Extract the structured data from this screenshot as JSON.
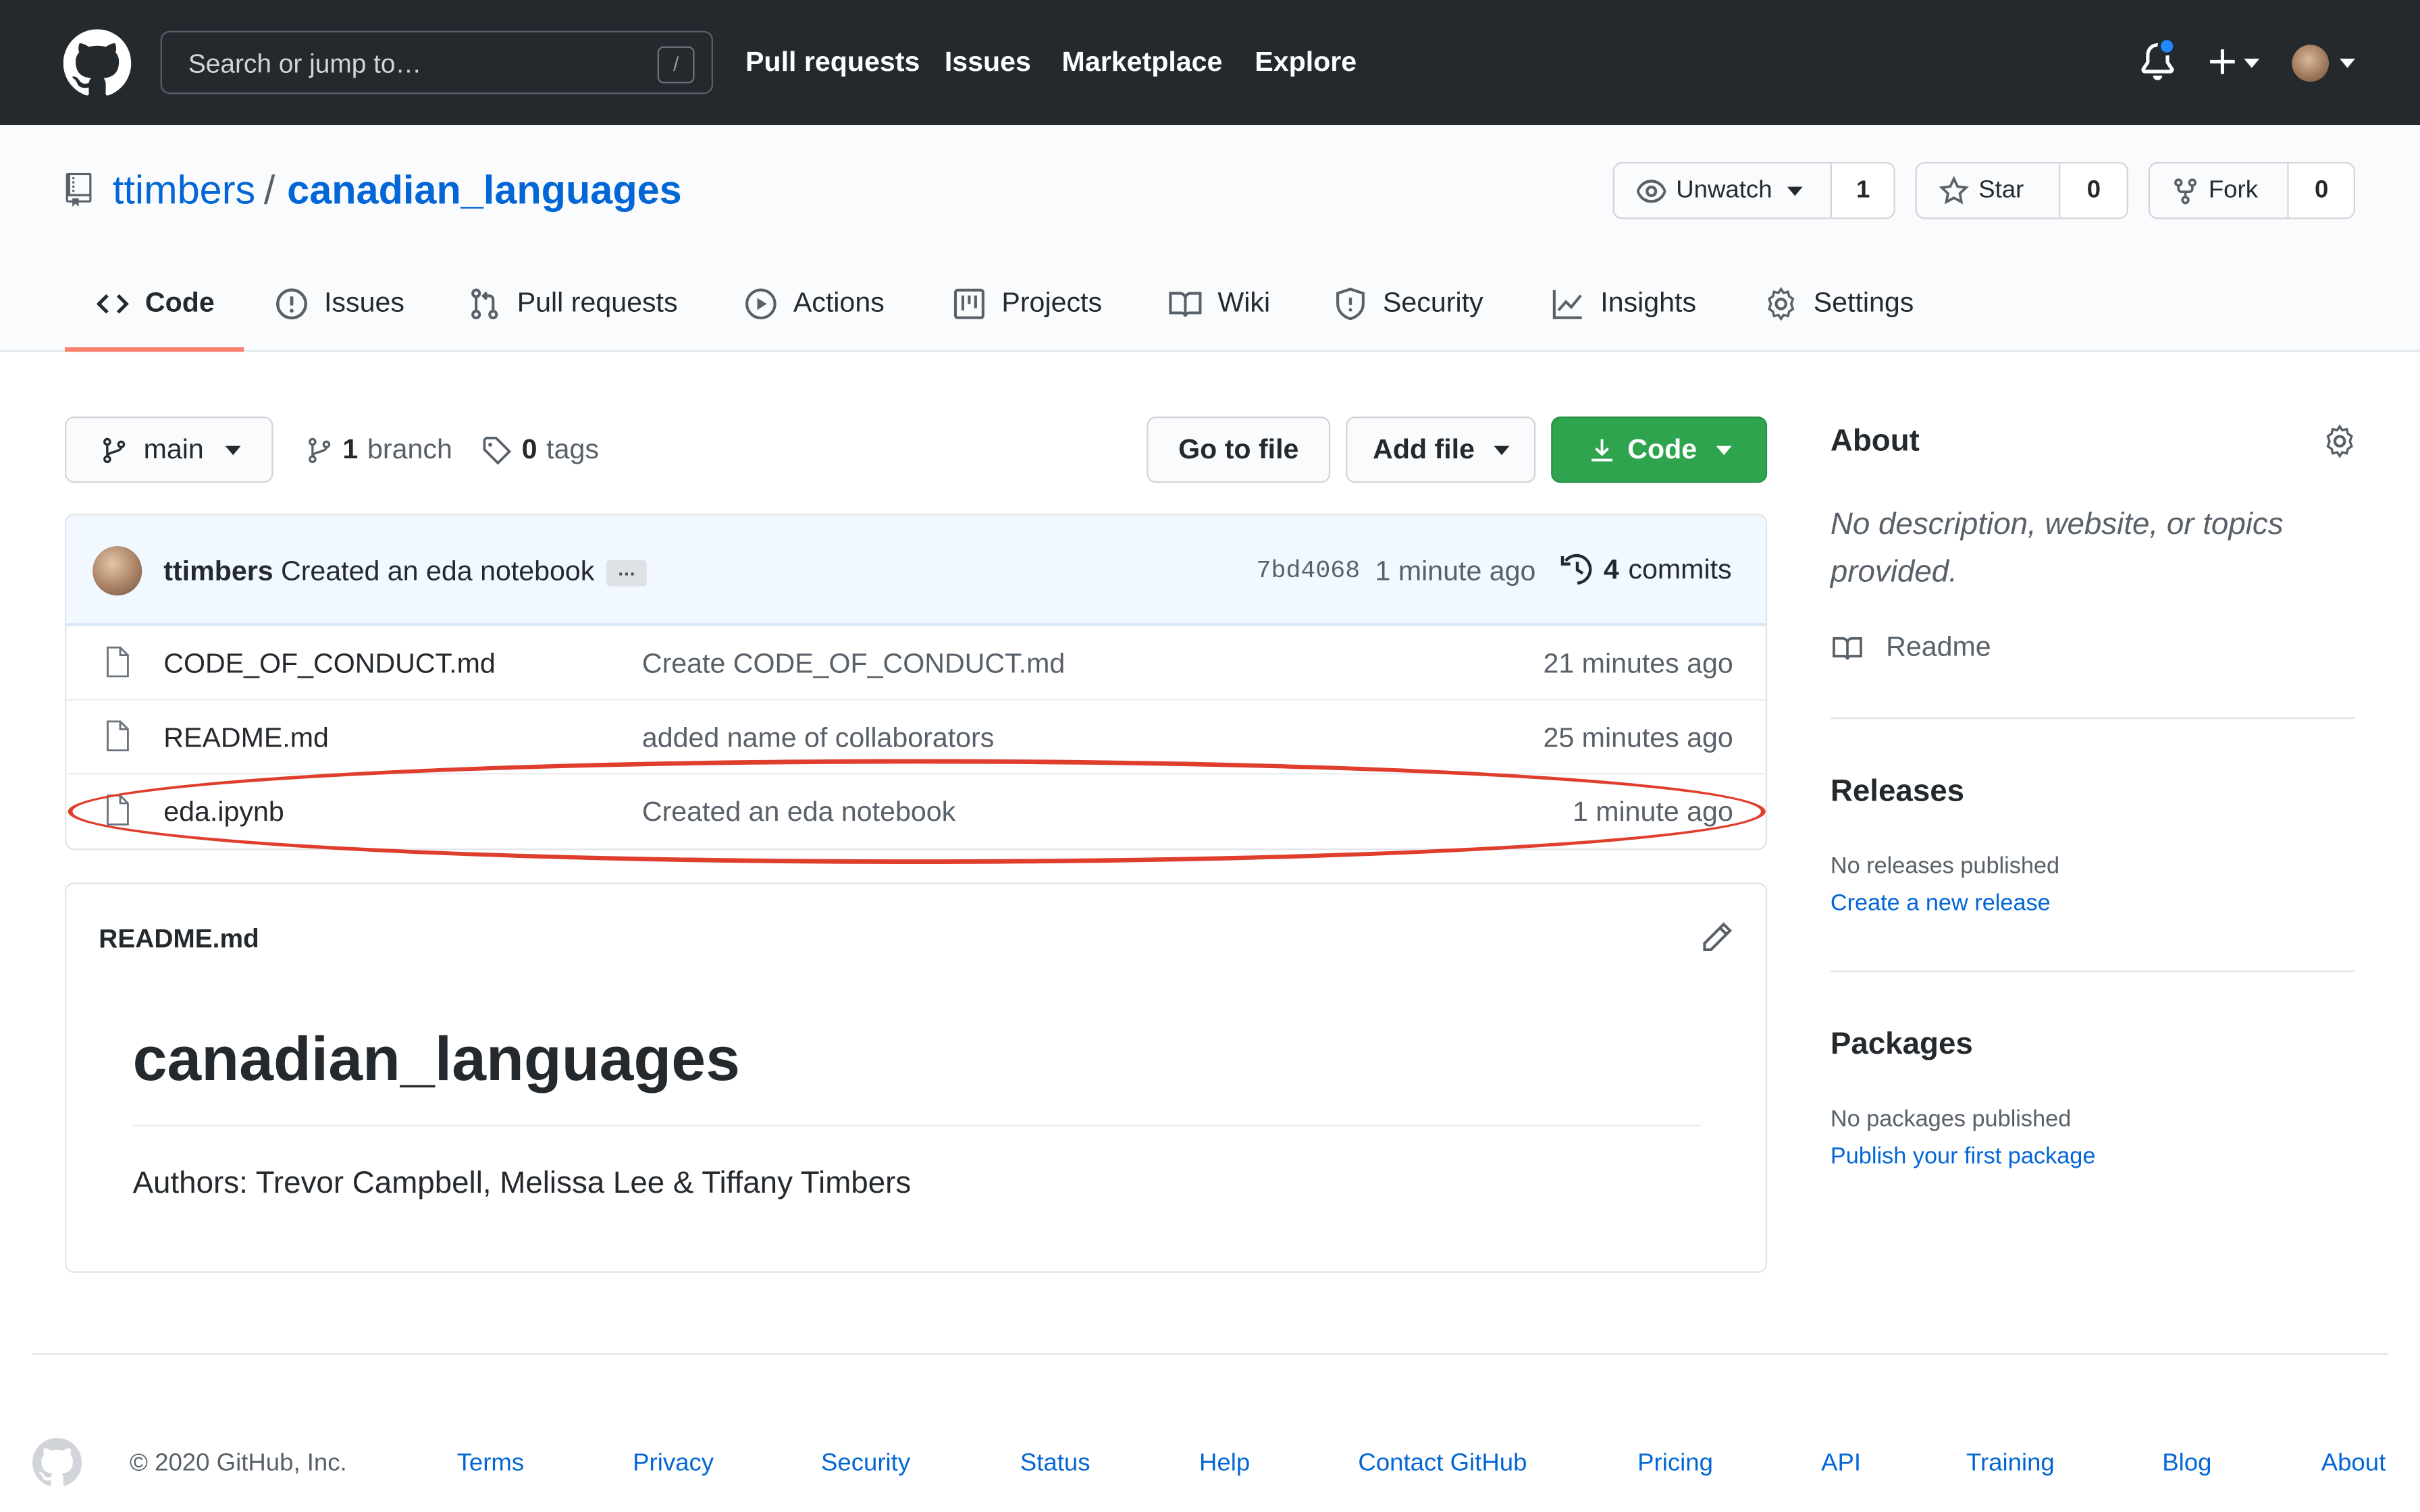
{
  "header": {
    "search_placeholder": "Search or jump to…",
    "search_shortcut": "/",
    "nav": [
      "Pull requests",
      "Issues",
      "Marketplace",
      "Explore"
    ]
  },
  "repo": {
    "owner": "ttimbers",
    "separator": "/",
    "name": "canadian_languages",
    "watch": {
      "label": "Unwatch",
      "count": "1"
    },
    "star": {
      "label": "Star",
      "count": "0"
    },
    "fork": {
      "label": "Fork",
      "count": "0"
    }
  },
  "tabs": [
    {
      "label": "Code",
      "icon": "code-icon",
      "active": true
    },
    {
      "label": "Issues",
      "icon": "issue-icon"
    },
    {
      "label": "Pull requests",
      "icon": "pull-request-icon"
    },
    {
      "label": "Actions",
      "icon": "play-icon"
    },
    {
      "label": "Projects",
      "icon": "project-icon"
    },
    {
      "label": "Wiki",
      "icon": "book-icon"
    },
    {
      "label": "Security",
      "icon": "shield-icon"
    },
    {
      "label": "Insights",
      "icon": "graph-icon"
    },
    {
      "label": "Settings",
      "icon": "gear-icon"
    }
  ],
  "toolbar": {
    "branch": "main",
    "branch_count": "1",
    "branch_label": "branch",
    "tag_count": "0",
    "tag_label": "tags",
    "go_to_file": "Go to file",
    "add_file": "Add file",
    "code": "Code"
  },
  "latest_commit": {
    "author": "ttimbers",
    "message": "Created an eda notebook",
    "ellipsis": "…",
    "sha": "7bd4068",
    "time": "1 minute ago",
    "commit_count": "4",
    "commit_label": "commits"
  },
  "files": [
    {
      "name": "CODE_OF_CONDUCT.md",
      "message": "Create CODE_OF_CONDUCT.md",
      "time": "21 minutes ago"
    },
    {
      "name": "README.md",
      "message": "added name of collaborators",
      "time": "25 minutes ago"
    },
    {
      "name": "eda.ipynb",
      "message": "Created an eda notebook",
      "time": "1 minute ago"
    }
  ],
  "readme": {
    "label": "README.md",
    "heading": "canadian_languages",
    "text": "Authors: Trevor Campbell, Melissa Lee & Tiffany Timbers"
  },
  "sidebar": {
    "about_title": "About",
    "about_desc": "No description, website, or topics provided.",
    "readme_link": "Readme",
    "releases_title": "Releases",
    "releases_text": "No releases published",
    "releases_link": "Create a new release",
    "packages_title": "Packages",
    "packages_text": "No packages published",
    "packages_link": "Publish your first package"
  },
  "footer": {
    "copyright": "© 2020 GitHub, Inc.",
    "links": [
      "Terms",
      "Privacy",
      "Security",
      "Status",
      "Help",
      "Contact GitHub",
      "Pricing",
      "API",
      "Training",
      "Blog",
      "About"
    ]
  },
  "colors": {
    "header_bg": "#24292e",
    "link": "#0366d6",
    "code_button": "#2ea44f",
    "active_tab_underline": "#f9826c",
    "annotation_ellipse": "#e03e2d"
  }
}
